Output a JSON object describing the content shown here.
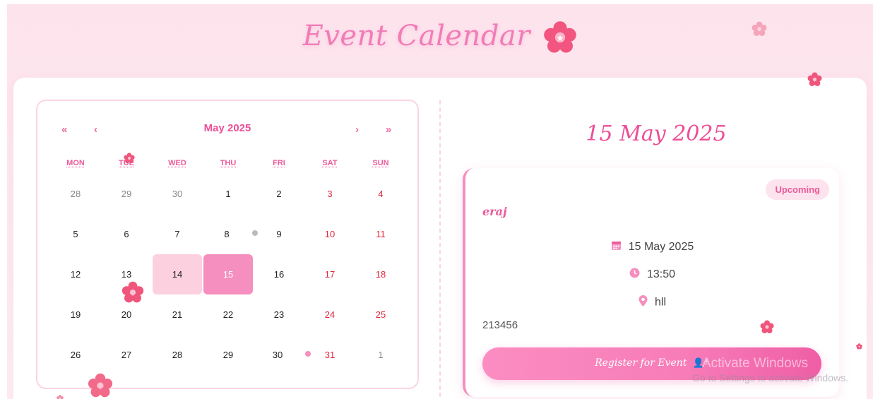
{
  "header": {
    "title": "Event Calendar"
  },
  "calendar": {
    "month_label": "May 2025",
    "nav": {
      "prev_year": "«",
      "prev_month": "‹",
      "next_month": "›",
      "next_year": "»"
    },
    "weekdays": [
      "MON",
      "TUE",
      "WED",
      "THU",
      "FRI",
      "SAT",
      "SUN"
    ],
    "days": [
      {
        "d": "28",
        "other": true
      },
      {
        "d": "29",
        "other": true
      },
      {
        "d": "30",
        "other": true
      },
      {
        "d": "1"
      },
      {
        "d": "2"
      },
      {
        "d": "3",
        "we": true
      },
      {
        "d": "4",
        "we": true
      },
      {
        "d": "5"
      },
      {
        "d": "6"
      },
      {
        "d": "7"
      },
      {
        "d": "8",
        "dot": "#bbbbbb"
      },
      {
        "d": "9"
      },
      {
        "d": "10",
        "we": true
      },
      {
        "d": "11",
        "we": true
      },
      {
        "d": "12"
      },
      {
        "d": "13"
      },
      {
        "d": "14",
        "today": true
      },
      {
        "d": "15",
        "selected": true
      },
      {
        "d": "16"
      },
      {
        "d": "17",
        "we": true
      },
      {
        "d": "18",
        "we": true
      },
      {
        "d": "19"
      },
      {
        "d": "20"
      },
      {
        "d": "21"
      },
      {
        "d": "22"
      },
      {
        "d": "23"
      },
      {
        "d": "24",
        "we": true
      },
      {
        "d": "25",
        "we": true
      },
      {
        "d": "26"
      },
      {
        "d": "27"
      },
      {
        "d": "28"
      },
      {
        "d": "29"
      },
      {
        "d": "30",
        "dot": "#f58fbf"
      },
      {
        "d": "31",
        "we": true
      },
      {
        "d": "1",
        "other": true
      }
    ]
  },
  "details": {
    "selected_date": "15 May 2025",
    "event": {
      "status": "Upcoming",
      "name": "eraj",
      "date": "15 May 2025",
      "time": "13:50",
      "location": "hll",
      "description": "213456",
      "register_label": "Register for Event"
    }
  },
  "watermark": {
    "line1": "Activate Windows",
    "line2": "Go to Settings to activate Windows."
  },
  "colors": {
    "accent": "#ec4f97",
    "selected": "#f58fbf",
    "today": "#fdd0df",
    "weekend": "#e0293f"
  }
}
